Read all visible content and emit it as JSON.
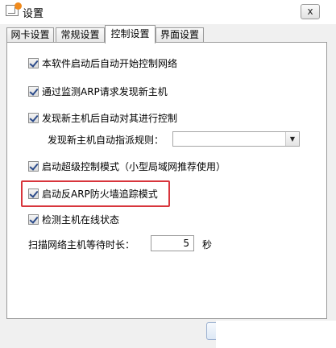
{
  "window": {
    "title": "设置",
    "close_label": "x"
  },
  "tabs": [
    {
      "label": "网卡设置",
      "active": false
    },
    {
      "label": "常规设置",
      "active": false
    },
    {
      "label": "控制设置",
      "active": true
    },
    {
      "label": "界面设置",
      "active": false
    }
  ],
  "options": {
    "auto_start_control": {
      "label": "本软件启动后自动开始控制网络",
      "checked": true
    },
    "arp_monitor": {
      "label": "通过监测ARP请求发现新主机",
      "checked": true
    },
    "control_new_host": {
      "label": "发现新主机后自动对其进行控制",
      "checked": true
    },
    "assign_rule": {
      "label": "发现新主机自动指派规则：",
      "value": ""
    },
    "super_control": {
      "label": "启动超级控制模式（小型局域网推荐使用）",
      "checked": true
    },
    "anti_arp_firewall": {
      "label": "启动反ARP防火墙追踪模式",
      "checked": true
    },
    "online_detect": {
      "label": "检测主机在线状态",
      "checked": true
    },
    "scan_wait": {
      "label": "扫描网络主机等待时长：",
      "value": "5",
      "unit": "秒"
    }
  },
  "colors": {
    "highlight_border": "#d8353c",
    "checkmark": "#2b4b8a"
  }
}
